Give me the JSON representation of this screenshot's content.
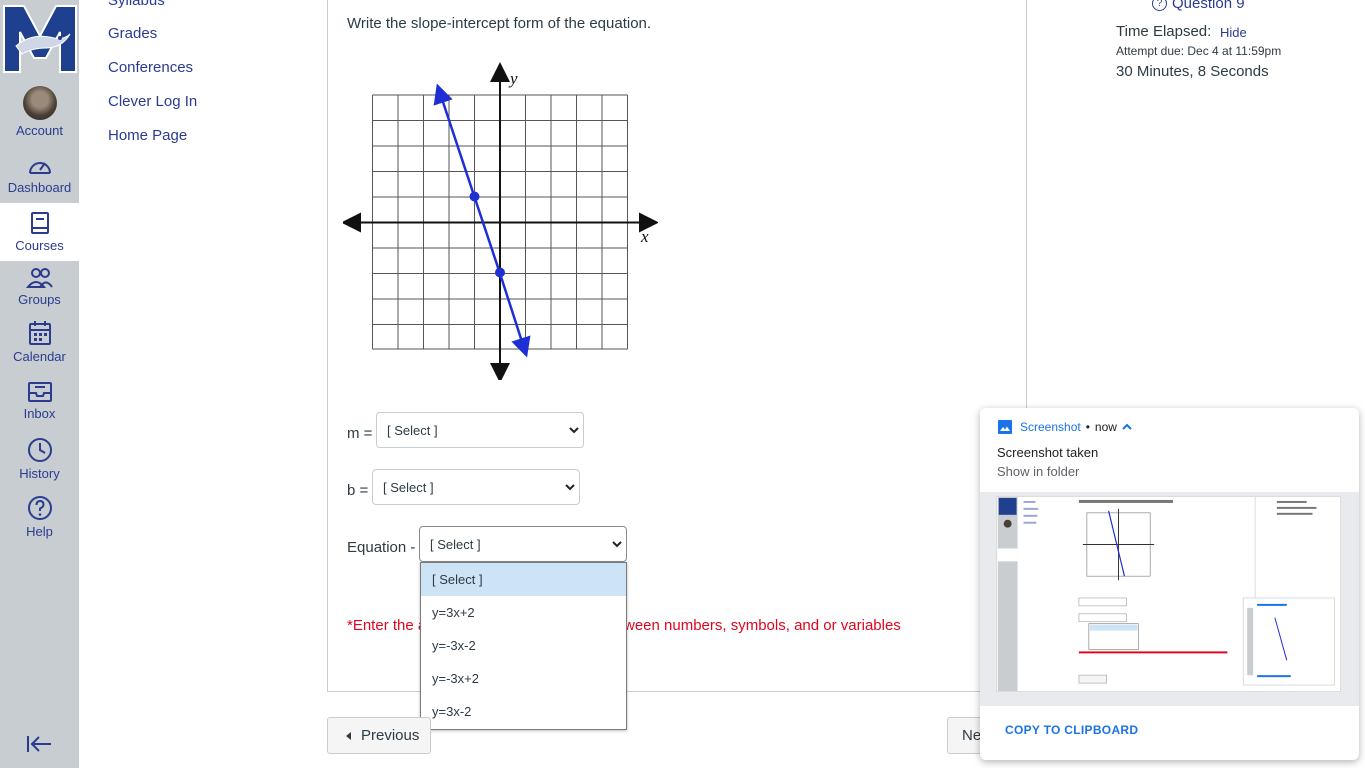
{
  "global_nav": {
    "items": [
      {
        "label": "Account",
        "icon": "avatar"
      },
      {
        "label": "Dashboard",
        "icon": "dashboard-icon"
      },
      {
        "label": "Courses",
        "icon": "courses-icon",
        "active": true
      },
      {
        "label": "Groups",
        "icon": "groups-icon"
      },
      {
        "label": "Calendar",
        "icon": "calendar-icon"
      },
      {
        "label": "Inbox",
        "icon": "inbox-icon"
      },
      {
        "label": "History",
        "icon": "history-icon"
      },
      {
        "label": "Help",
        "icon": "help-icon"
      }
    ],
    "colors": {
      "nav_bg": "#c7cdd1",
      "link": "#2b3b8f"
    }
  },
  "course_nav": {
    "items": [
      "Syllabus",
      "Grades",
      "Conferences",
      "Clever Log In",
      "Home Page"
    ]
  },
  "question": {
    "text": "Write the slope-intercept form of the equation.",
    "graph": {
      "x_axis_label": "x",
      "y_axis_label": "y",
      "points": [
        [
          -1,
          1
        ],
        [
          0,
          -2
        ]
      ]
    },
    "fields": [
      {
        "label": "m =",
        "value": "[ Select ]"
      },
      {
        "label": "b =",
        "value": "[ Select ]"
      },
      {
        "label": "Equation -",
        "value": "[ Select ]"
      }
    ],
    "dropdown_options": [
      "[ Select ]",
      "y=3x+2",
      "y=-3x-2",
      "y=-3x+2",
      "y=3x-2"
    ],
    "note_start": "*Enter the a",
    "note_end": "ween numbers, symbols, and or variables",
    "note_color": "#e0061f"
  },
  "footer": {
    "previous_label": "Previous",
    "next_label": "Ne"
  },
  "sidebar": {
    "question_link": "Question 9",
    "time_label": "Time Elapsed:",
    "hide_label": "Hide",
    "due": "Attempt due: Dec 4 at 11:59pm",
    "elapsed": "30 Minutes, 8 Seconds"
  },
  "notification": {
    "app": "Screenshot",
    "time": "now",
    "title": "Screenshot taken",
    "subtitle": "Show in folder",
    "action": "COPY TO CLIPBOARD",
    "accent": "#1a73e8"
  }
}
